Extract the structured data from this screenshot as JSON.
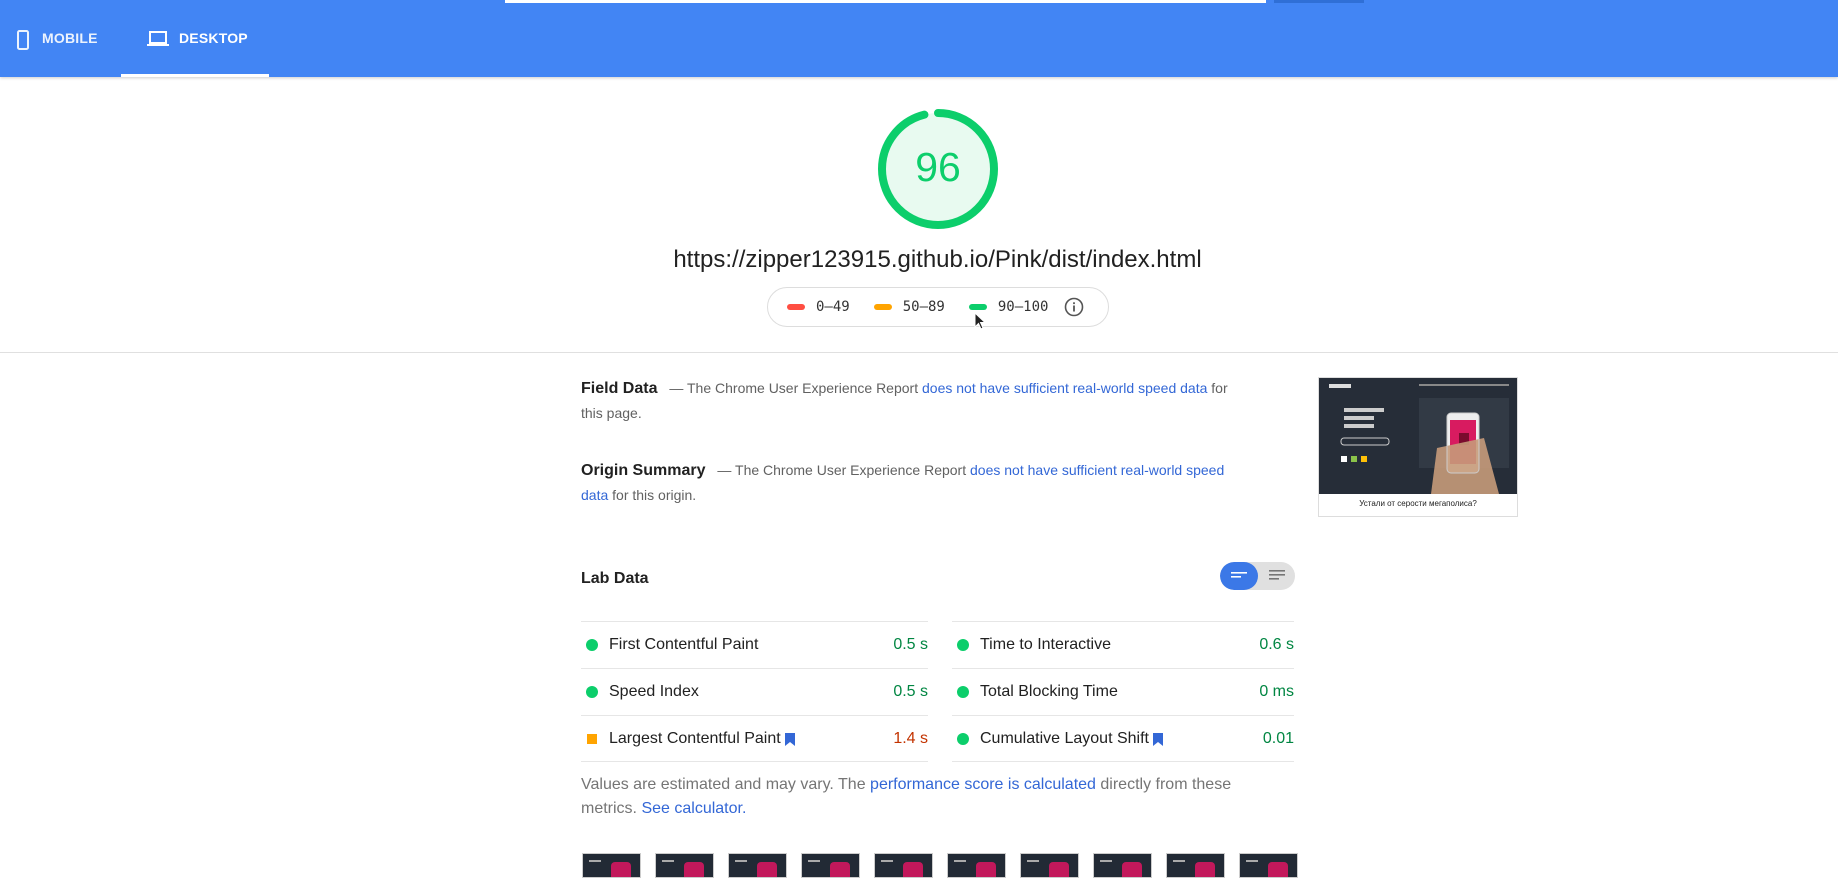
{
  "header": {
    "tabs": [
      {
        "label": "MOBILE",
        "icon": "phone-icon",
        "active": false
      },
      {
        "label": "DESKTOP",
        "icon": "laptop-icon",
        "active": true
      }
    ],
    "colors": {
      "background": "#4285f4",
      "text": "#ffffff"
    }
  },
  "score": {
    "value": "96",
    "fraction": 0.96,
    "color": "#0cce6b"
  },
  "page_url": "https://zipper123915.github.io/Pink/dist/index.html",
  "legend": {
    "items": [
      {
        "label": "0–49",
        "color": "#ff4e42"
      },
      {
        "label": "50–89",
        "color": "#ffa400"
      },
      {
        "label": "90–100",
        "color": "#0cce6b"
      }
    ],
    "info_icon": "info-icon"
  },
  "field_data": {
    "title": "Field Data",
    "dash": "—",
    "prefix": "The Chrome User Experience Report",
    "link": "does not have sufficient real-world speed data",
    "suffix": "for this page."
  },
  "origin_summary": {
    "title": "Origin Summary",
    "dash": "—",
    "prefix": "The Chrome User Experience Report",
    "link": "does not have sufficient real-world speed data",
    "suffix": "for this origin."
  },
  "screenshot": {
    "caption": "Устали от серости мегаполиса?"
  },
  "lab_data": {
    "title": "Lab Data",
    "metrics_left": [
      {
        "name": "First Contentful Paint",
        "value": "0.5 s",
        "status": "pass"
      },
      {
        "name": "Speed Index",
        "value": "0.5 s",
        "status": "pass"
      },
      {
        "name": "Largest Contentful Paint",
        "value": "1.4 s",
        "status": "average"
      }
    ],
    "metrics_right": [
      {
        "name": "Time to Interactive",
        "value": "0.6 s",
        "status": "pass"
      },
      {
        "name": "Total Blocking Time",
        "value": "0 ms",
        "status": "pass"
      },
      {
        "name": "Cumulative Layout Shift",
        "value": "0.01",
        "status": "pass"
      }
    ]
  },
  "estimate": {
    "prefix": "Values are estimated and may vary. The",
    "link1": "performance score is calculated",
    "middle": "directly from these metrics.",
    "link2": "See calculator."
  }
}
